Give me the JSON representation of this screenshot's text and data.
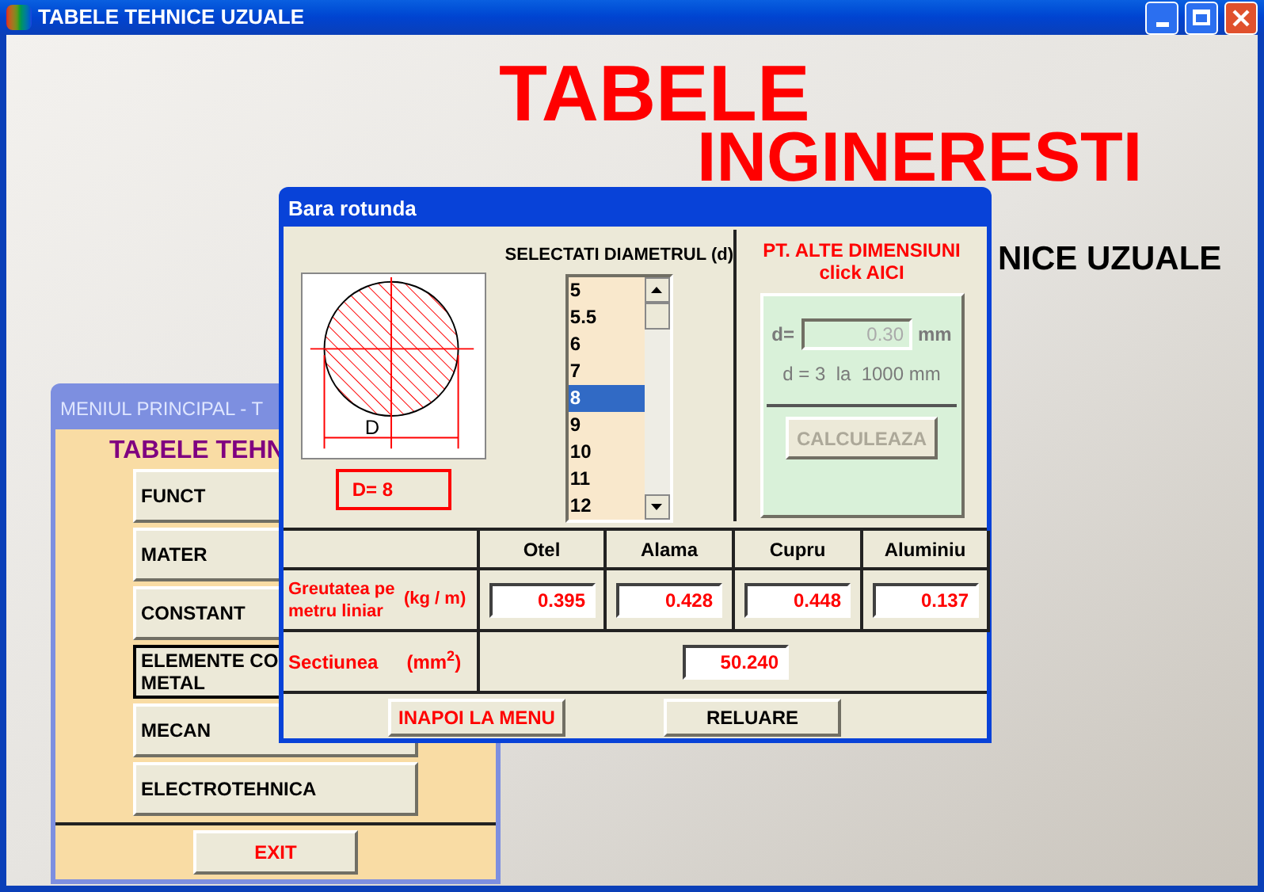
{
  "window": {
    "title": "TABELE TEHNICE UZUALE"
  },
  "banner": {
    "title_1": "TABELE",
    "title_2": "INGINERESTI",
    "subtitle": "NICE UZUALE"
  },
  "menu_window": {
    "title": "MENIUL PRINCIPAL - T",
    "heading": "TABELE TEHN",
    "buttons": [
      {
        "label": "FUNCT",
        "focused": false
      },
      {
        "label": "MATER",
        "focused": false
      },
      {
        "label": "CONSTANT",
        "focused": false
      },
      {
        "label": "ELEMENTE CO\nMETAL",
        "focused": true
      },
      {
        "label": "MECAN",
        "focused": false
      },
      {
        "label": "ELECTROTEHNICA",
        "focused": false
      }
    ],
    "exit": "EXIT"
  },
  "dialog": {
    "title": "Bara rotunda",
    "drawing_label": "D",
    "diameter_readout": "D= 8",
    "list_title": "SELECTATI DIAMETRUL (d)",
    "diameters": [
      {
        "label": "5",
        "selected": false
      },
      {
        "label": "5.5",
        "selected": false
      },
      {
        "label": "6",
        "selected": false
      },
      {
        "label": "7",
        "selected": false
      },
      {
        "label": "8",
        "selected": true
      },
      {
        "label": "9",
        "selected": false
      },
      {
        "label": "10",
        "selected": false
      },
      {
        "label": "11",
        "selected": false
      },
      {
        "label": "12",
        "selected": false
      }
    ],
    "custom": {
      "title_1": "PT. ALTE DIMENSIUNI",
      "title_2": "click AICI",
      "field_label": "d=",
      "value": "0.30",
      "unit": "mm",
      "range": "d = 3  la  1000 mm",
      "button": "CALCULEAZA",
      "disabled": true
    },
    "table": {
      "columns": [
        "Otel",
        "Alama",
        "Cupru",
        "Aluminiu"
      ],
      "weight_label": "Greutatea pe metru liniar",
      "weight_unit": "(kg / m)",
      "weights": [
        "0.395",
        "0.428",
        "0.448",
        "0.137"
      ],
      "section_label": "Sectiunea",
      "section_unit": "(mm$^{2}$)",
      "section_value": "50.240"
    },
    "buttons": [
      "INAPOI LA MENU",
      "RELUARE"
    ]
  }
}
